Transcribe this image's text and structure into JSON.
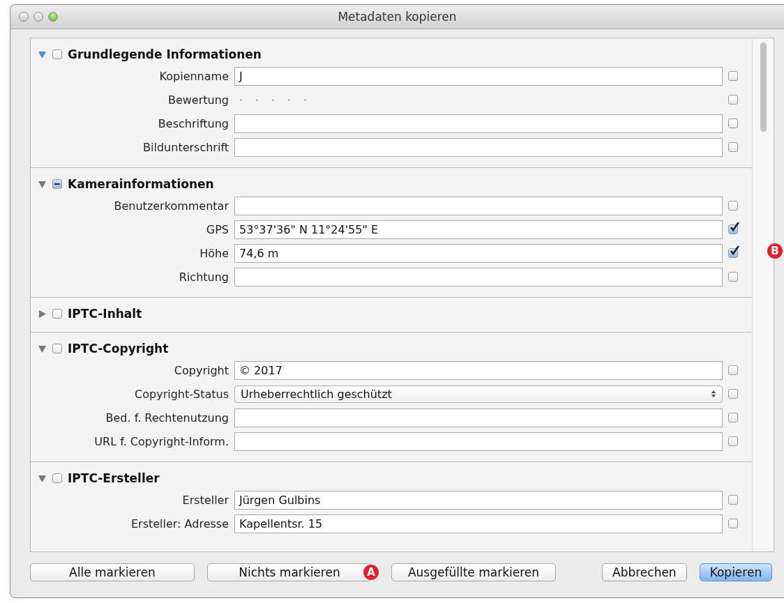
{
  "window": {
    "title": "Metadaten kopieren"
  },
  "sections": [
    {
      "title": "Grundlegende Informationen",
      "expanded": true,
      "focused": true,
      "mixed": false,
      "rows": [
        {
          "kind": "field",
          "label": "Kopienname",
          "value": "J",
          "checked": false
        },
        {
          "kind": "rating",
          "label": "Bewertung",
          "stars": 0,
          "checked": false
        },
        {
          "kind": "field",
          "label": "Beschriftung",
          "checked": false
        },
        {
          "kind": "field",
          "label": "Bildunterschrift",
          "checked": false
        }
      ]
    },
    {
      "title": "Kamerainformationen",
      "expanded": true,
      "focused": false,
      "mixed": true,
      "rows": [
        {
          "kind": "field",
          "label": "Benutzerkommentar",
          "checked": false
        },
        {
          "kind": "field",
          "label": "GPS",
          "value": "53°37'36\" N 11°24'55\" E",
          "checked": true
        },
        {
          "kind": "field",
          "label": "Höhe",
          "value": "74,6 m",
          "checked": true
        },
        {
          "kind": "field",
          "label": "Richtung",
          "checked": false
        }
      ]
    },
    {
      "title": "IPTC-Inhalt",
      "expanded": false,
      "focused": false,
      "mixed": false
    },
    {
      "title": "IPTC-Copyright",
      "expanded": true,
      "focused": false,
      "mixed": false,
      "rows": [
        {
          "kind": "field",
          "label": "Copyright",
          "value": "© 2017",
          "checked": false
        },
        {
          "kind": "popup",
          "label": "Copyright-Status",
          "value": "Urheberrechtlich geschützt",
          "checked": false
        },
        {
          "kind": "field",
          "label": "Bed. f. Rechtenutzung",
          "checked": false
        },
        {
          "kind": "field",
          "label": "URL f. Copyright-Inform.",
          "checked": false
        }
      ]
    },
    {
      "title": "IPTC-Ersteller",
      "expanded": true,
      "focused": false,
      "mixed": false,
      "rows": [
        {
          "kind": "field",
          "label": "Ersteller",
          "value": "Jürgen Gulbins",
          "checked": false
        },
        {
          "kind": "field",
          "label": "Ersteller: Adresse",
          "value": "Kapellentsr. 15",
          "checked": false
        }
      ]
    }
  ],
  "left_buttons": [
    {
      "label": "Alle markieren"
    },
    {
      "label": "Nichts markieren",
      "callout": "A"
    },
    {
      "label": "Ausgefüllte markieren"
    }
  ],
  "right_buttons": [
    {
      "label": "Abbrechen",
      "default": false
    },
    {
      "label": "Kopieren",
      "default": true
    }
  ],
  "side_callout": "B"
}
